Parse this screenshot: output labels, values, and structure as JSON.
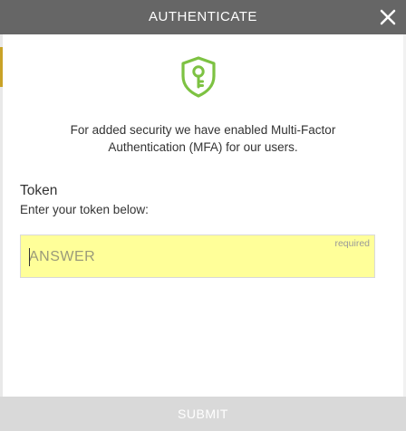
{
  "header": {
    "title": "AUTHENTICATE"
  },
  "icons": {
    "shield": "shield-key-icon",
    "close": "close-icon"
  },
  "colors": {
    "header_bg": "#666666",
    "shield_green": "#7dc242",
    "input_highlight": "#ffff99",
    "submit_bg": "#d9d9d9"
  },
  "intro": {
    "line1": "For added security we have enabled Multi-Factor",
    "line2": "Authentication (MFA) for our users."
  },
  "token": {
    "label": "Token",
    "hint": "Enter your token below:",
    "required_text": "required",
    "placeholder": "ANSWER",
    "value": ""
  },
  "footer": {
    "submit_label": "SUBMIT"
  }
}
